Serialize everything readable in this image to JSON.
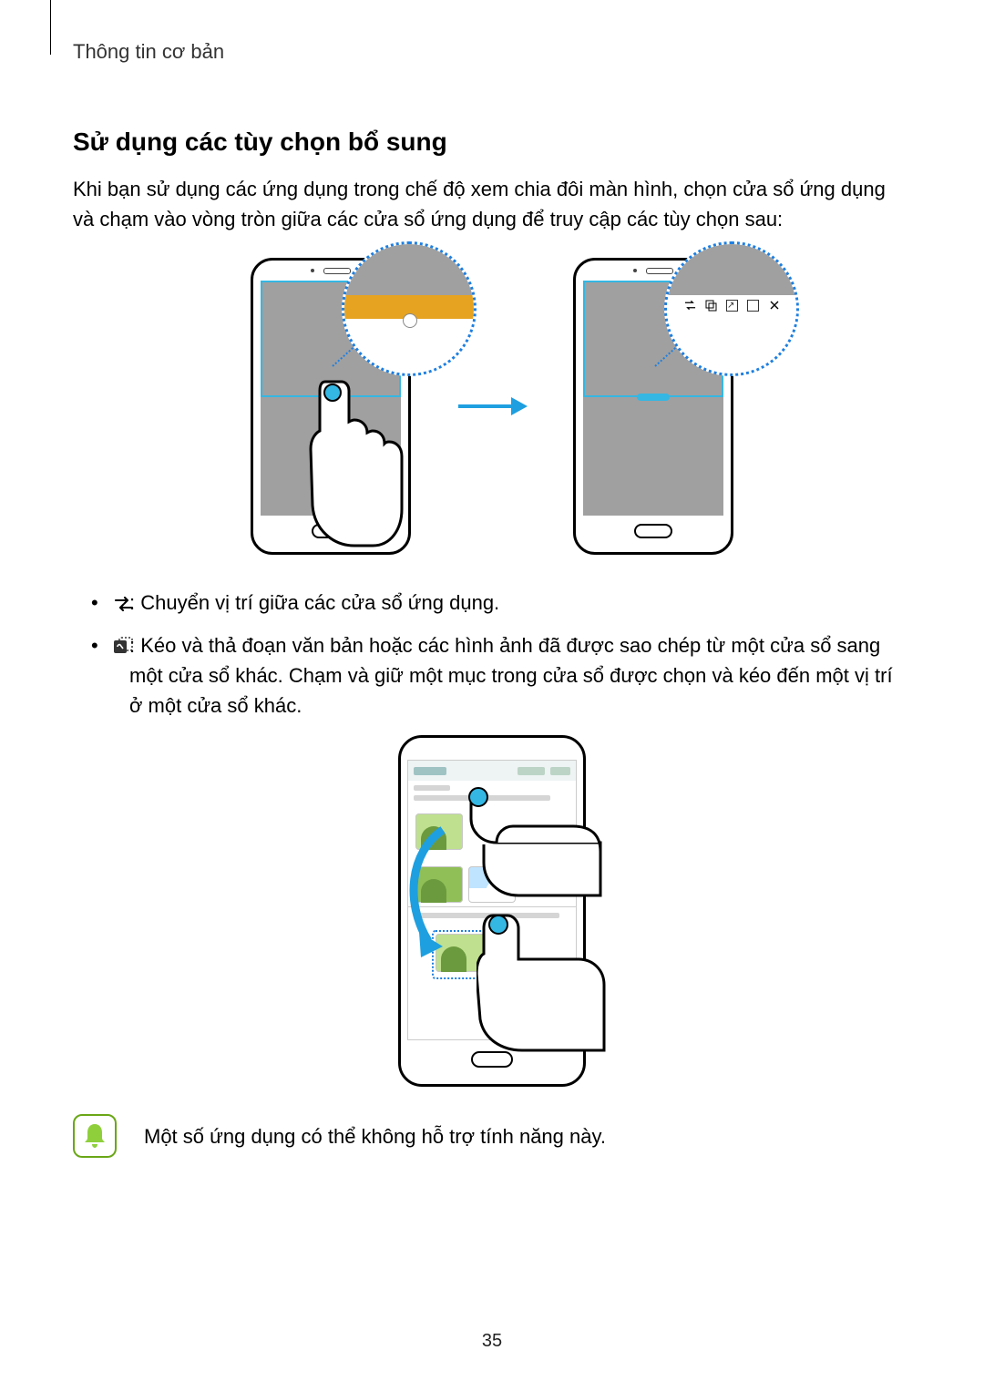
{
  "breadcrumb": "Thông tin cơ bản",
  "section_title": "Sử dụng các tùy chọn bổ sung",
  "intro": "Khi bạn sử dụng các ứng dụng trong chế độ xem chia đôi màn hình, chọn cửa sổ ứng dụng và chạm vào vòng tròn giữa các cửa sổ ứng dụng để truy cập các tùy chọn sau:",
  "bullets": {
    "b0": " : Chuyển vị trí giữa các cửa sổ ứng dụng.",
    "b1": " : Kéo và thả đoạn văn bản hoặc các hình ảnh đã được sao chép từ một cửa sổ sang một cửa sổ khác. Chạm và giữ một mục trong cửa sổ được chọn và kéo đến một vị trí ở một cửa sổ khác."
  },
  "note_text": "Một số ứng dụng có thể không hỗ trợ tính năng này.",
  "page_number": "35",
  "icons": {
    "swap": "swap-windows-icon",
    "drag": "drag-content-icon",
    "arrow": "arrow-right-icon",
    "bell": "notice-bell-icon",
    "hand": "hand-pointer-icon",
    "close": "close-x-icon",
    "expand": "expand-icon"
  }
}
